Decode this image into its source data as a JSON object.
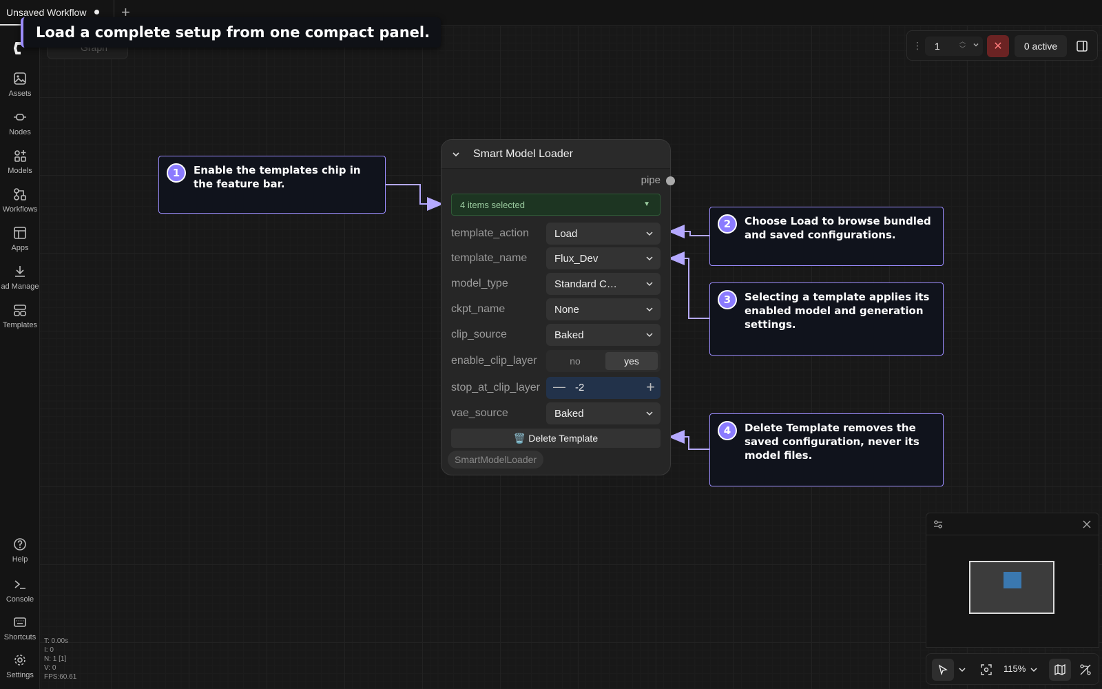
{
  "tab": {
    "title": "Unsaved Workflow",
    "add": "+"
  },
  "banner": {
    "text": "Load a complete setup from one compact panel."
  },
  "graph_chip": {
    "label": "Graph"
  },
  "sidebar": {
    "items": [
      {
        "label": "Assets",
        "icon": "image-icon"
      },
      {
        "label": "Nodes",
        "icon": "node-icon"
      },
      {
        "label": "Models",
        "icon": "models-icon"
      },
      {
        "label": "Workflows",
        "icon": "workflow-icon"
      },
      {
        "label": "Apps",
        "icon": "apps-icon"
      },
      {
        "label": "ad Manage",
        "icon": "download-icon"
      },
      {
        "label": "Templates",
        "icon": "templates-icon"
      }
    ],
    "bottom": [
      {
        "label": "Help",
        "icon": "help-icon"
      },
      {
        "label": "Console",
        "icon": "console-icon"
      },
      {
        "label": "Shortcuts",
        "icon": "keyboard-icon"
      },
      {
        "label": "Settings",
        "icon": "gear-icon"
      }
    ]
  },
  "toolbar": {
    "queue_count": "1",
    "active_label": "0 active"
  },
  "node": {
    "title": "Smart Model Loader",
    "output": "pipe",
    "multiselect": "4 items selected",
    "widgets": [
      {
        "label": "template_action",
        "value": "Load"
      },
      {
        "label": "template_name",
        "value": "Flux_Dev"
      },
      {
        "label": "model_type",
        "value": "Standard C…"
      },
      {
        "label": "ckpt_name",
        "value": "None"
      },
      {
        "label": "clip_source",
        "value": "Baked"
      }
    ],
    "toggle": {
      "label": "enable_clip_layer",
      "off": "no",
      "on": "yes"
    },
    "stepper": {
      "label": "stop_at_clip_layer",
      "value": "-2"
    },
    "vae": {
      "label": "vae_source",
      "value": "Baked"
    },
    "delete_label": "🗑️ Delete Template",
    "class_tag": "SmartModelLoader"
  },
  "callouts": [
    {
      "num": "1",
      "text": "Enable the templates chip in the feature bar."
    },
    {
      "num": "2",
      "text": "Choose Load to browse bundled and saved configurations."
    },
    {
      "num": "3",
      "text": "Selecting a template applies its enabled model and generation settings."
    },
    {
      "num": "4",
      "text": "Delete Template removes the saved configuration, never its model files."
    }
  ],
  "zoom": {
    "level": "115%"
  },
  "stats": {
    "t": "T: 0.00s",
    "i": "I: 0",
    "n": "N: 1 [1]",
    "v": "V: 0",
    "fps": "FPS:60.61"
  },
  "colors": {
    "accent": "#9b8cff",
    "canvas": "#181818",
    "multiselect": "#1d3522",
    "stop": "#6b2323"
  }
}
